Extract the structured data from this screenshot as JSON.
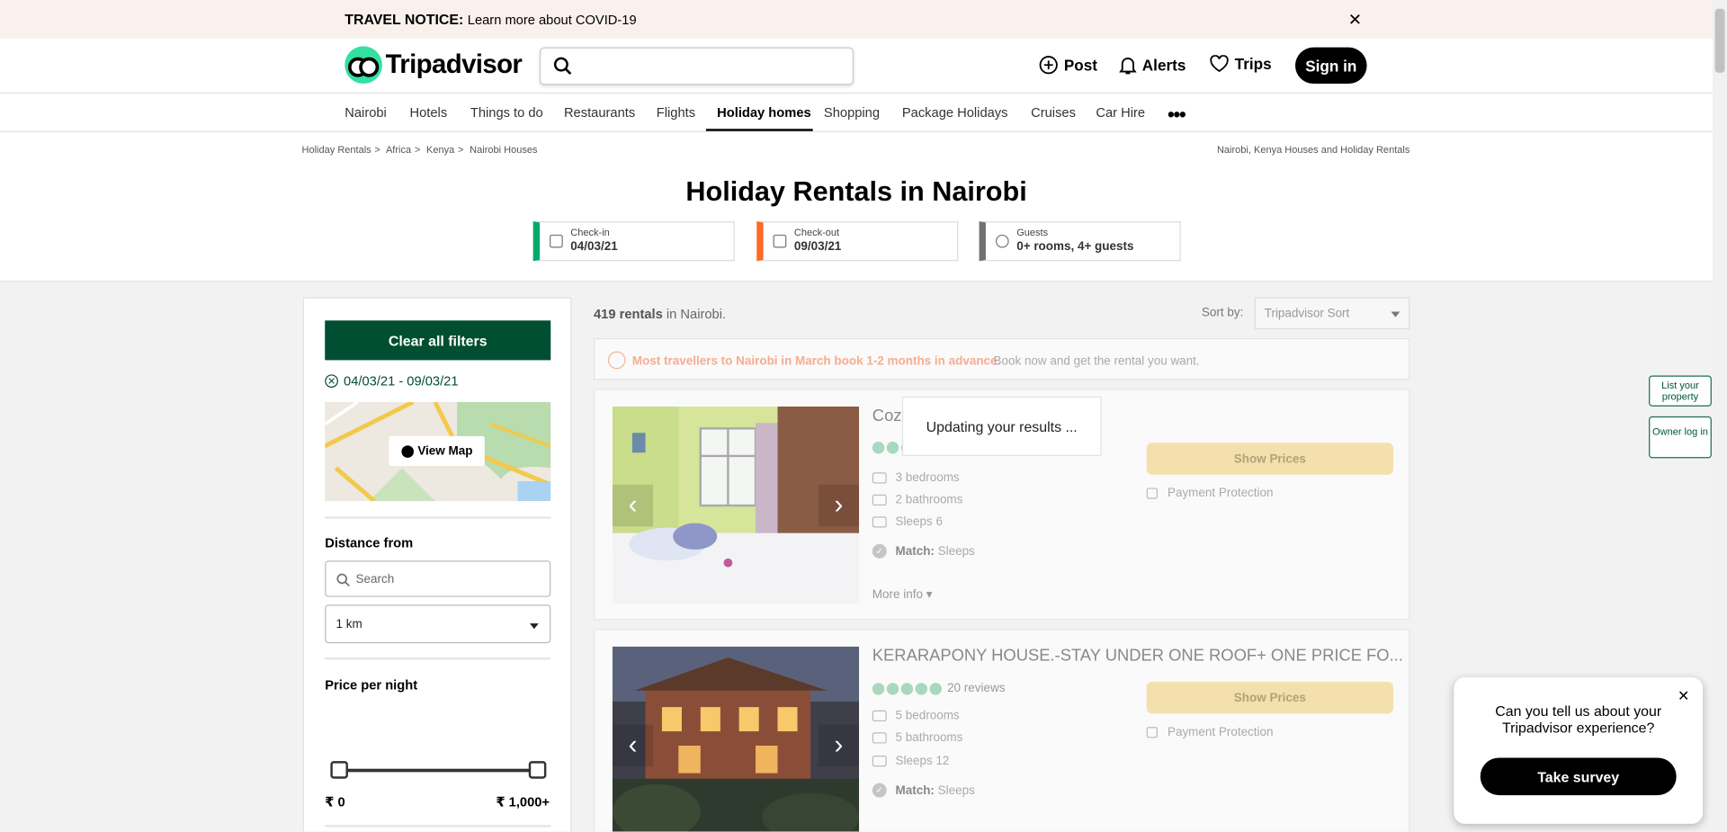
{
  "notice": {
    "label": "TRAVEL NOTICE:",
    "link": "Learn more about COVID-19"
  },
  "header": {
    "brand": "Tripadvisor",
    "nav": {
      "post": "Post",
      "alerts": "Alerts",
      "trips": "Trips"
    },
    "signin": "Sign in"
  },
  "categories": [
    "Nairobi",
    "Hotels",
    "Things to do",
    "Restaurants",
    "Flights",
    "Holiday homes",
    "Shopping",
    "Package Holidays",
    "Cruises",
    "Car Hire"
  ],
  "active_category": "Holiday homes",
  "breadcrumbs": [
    "Holiday Rentals",
    "Africa",
    "Kenya",
    "Nairobi Houses"
  ],
  "breadcrumb_right": "Nairobi, Kenya Houses and Holiday Rentals",
  "page_title": "Holiday Rentals in Nairobi",
  "dates": {
    "checkin": {
      "label": "Check-in",
      "value": "04/03/21",
      "color": "#00aa6c"
    },
    "checkout": {
      "label": "Check-out",
      "value": "09/03/21",
      "color": "#ff6a24"
    },
    "guests": {
      "label": "Guests",
      "value": "0+ rooms, 4+ guests",
      "color": "#707070"
    }
  },
  "sidebar": {
    "clear_filters": "Clear all filters",
    "date_filter": "04/03/21 - 09/03/21",
    "view_map": "View Map",
    "distance_heading": "Distance from",
    "distance_placeholder": "Search",
    "distance_value": "1 km",
    "price_heading": "Price per night",
    "price_min": "₹ 0",
    "price_max": "₹ 1,000+"
  },
  "results": {
    "count": "419 rentals",
    "location": "in Nairobi.",
    "sort_label": "Sort by:",
    "sort_value": "Tripadvisor Sort",
    "tip_strong": "Most travellers to Nairobi in March book 1-2 months in advance.",
    "tip_rest": "Book now and get the rental you want.",
    "updating": "Updating your results ..."
  },
  "listings": [
    {
      "title": "Cozy Private - 3 Ro...",
      "reviews": "",
      "bedrooms": "3 bedrooms",
      "bathrooms": "2 bathrooms",
      "sleeps": "Sleeps 6",
      "match_label": "Match:",
      "match_value": "Sleeps",
      "more_info": "More info",
      "show_prices": "Show Prices",
      "protection": "Payment Protection"
    },
    {
      "title": "KERARAPONY HOUSE.-STAY UNDER ONE ROOF+ ONE PRICE FO...",
      "reviews": "20 reviews",
      "bedrooms": "5 bedrooms",
      "bathrooms": "5 bathrooms",
      "sleeps": "Sleeps 12",
      "match_label": "Match:",
      "match_value": "Sleeps",
      "more_info": "More info",
      "show_prices": "Show Prices",
      "protection": "Payment Protection"
    }
  ],
  "side_tabs": {
    "list": "List your property",
    "owner": "Owner log in"
  },
  "survey": {
    "question": "Can you tell us about your Tripadvisor experience?",
    "button": "Take survey"
  }
}
